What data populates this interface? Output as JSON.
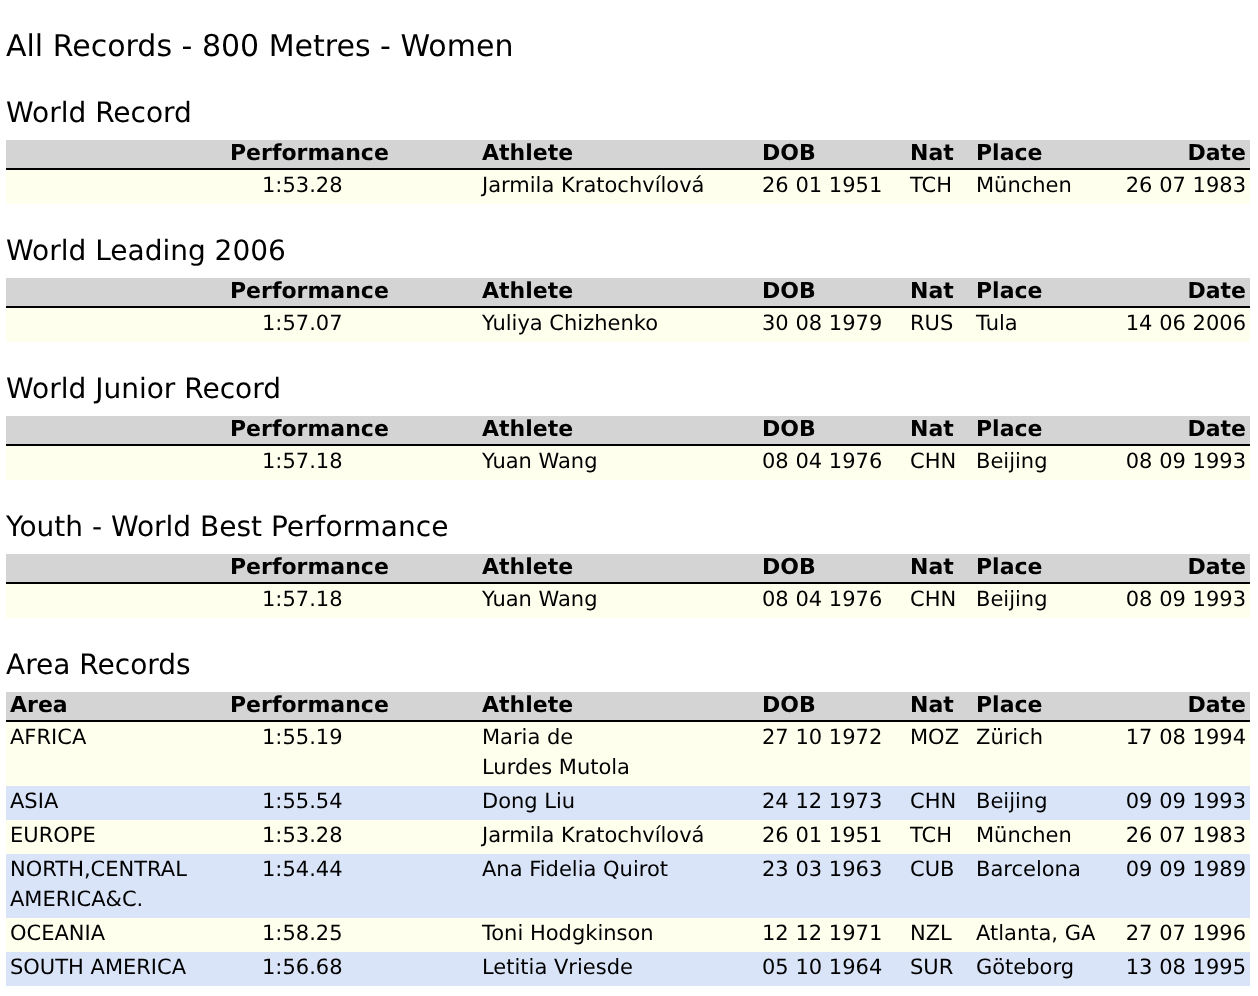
{
  "title": "All Records - 800 Metres - Women",
  "sections": [
    {
      "heading": "World Record",
      "columns": [
        "Performance",
        "Athlete",
        "DOB",
        "Nat",
        "Place",
        "Date"
      ],
      "rows": [
        {
          "performance": "1:53.28",
          "athlete": [
            "Jarmila Kratochvílová"
          ],
          "dob": "26 01 1951",
          "nat": "TCH",
          "place": "München",
          "date": "26 07 1983"
        }
      ]
    },
    {
      "heading": "World Leading 2006",
      "columns": [
        "Performance",
        "Athlete",
        "DOB",
        "Nat",
        "Place",
        "Date"
      ],
      "rows": [
        {
          "performance": "1:57.07",
          "athlete": [
            "Yuliya Chizhenko"
          ],
          "dob": "30 08 1979",
          "nat": "RUS",
          "place": "Tula",
          "date": "14 06 2006"
        }
      ]
    },
    {
      "heading": "World Junior Record",
      "columns": [
        "Performance",
        "Athlete",
        "DOB",
        "Nat",
        "Place",
        "Date"
      ],
      "rows": [
        {
          "performance": "1:57.18",
          "athlete": [
            "Yuan Wang"
          ],
          "dob": "08 04 1976",
          "nat": "CHN",
          "place": "Beijing",
          "date": "08 09 1993"
        }
      ]
    },
    {
      "heading": "Youth - World Best Performance",
      "columns": [
        "Performance",
        "Athlete",
        "DOB",
        "Nat",
        "Place",
        "Date"
      ],
      "rows": [
        {
          "performance": "1:57.18",
          "athlete": [
            "Yuan Wang"
          ],
          "dob": "08 04 1976",
          "nat": "CHN",
          "place": "Beijing",
          "date": "08 09 1993"
        }
      ]
    },
    {
      "heading": "Area Records",
      "columns": [
        "Area",
        "Performance",
        "Athlete",
        "DOB",
        "Nat",
        "Place",
        "Date"
      ],
      "rows": [
        {
          "area": "AFRICA",
          "performance": "1:55.19",
          "athlete": [
            "Maria de",
            "Lurdes Mutola"
          ],
          "dob": "27 10 1972",
          "nat": "MOZ",
          "place": "Zürich",
          "date": "17 08 1994"
        },
        {
          "area": "ASIA",
          "performance": "1:55.54",
          "athlete": [
            "Dong Liu"
          ],
          "dob": "24 12 1973",
          "nat": "CHN",
          "place": "Beijing",
          "date": "09 09 1993"
        },
        {
          "area": "EUROPE",
          "performance": "1:53.28",
          "athlete": [
            "Jarmila Kratochvílová"
          ],
          "dob": "26 01 1951",
          "nat": "TCH",
          "place": "München",
          "date": "26 07 1983"
        },
        {
          "area": "NORTH,CENTRAL AMERICA&C.",
          "performance": "1:54.44",
          "athlete": [
            "Ana Fidelia Quirot"
          ],
          "dob": "23 03 1963",
          "nat": "CUB",
          "place": "Barcelona",
          "date": "09 09 1989"
        },
        {
          "area": "OCEANIA",
          "performance": "1:58.25",
          "athlete": [
            "Toni Hodgkinson"
          ],
          "dob": "12 12 1971",
          "nat": "NZL",
          "place": "Atlanta, GA",
          "date": "27 07 1996"
        },
        {
          "area": "SOUTH AMERICA",
          "performance": "1:56.68",
          "athlete": [
            "Letitia Vriesde"
          ],
          "dob": "05 10 1964",
          "nat": "SUR",
          "place": "Göteborg",
          "date": "13 08 1995"
        }
      ]
    }
  ]
}
